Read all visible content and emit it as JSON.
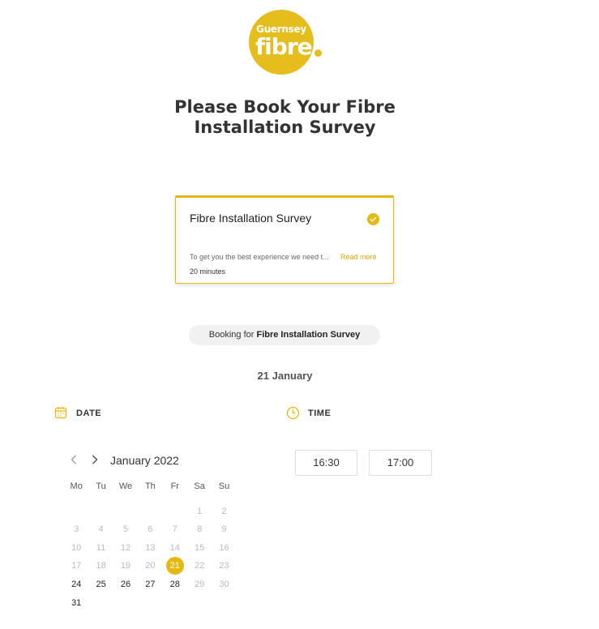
{
  "logo": {
    "line1": "Guernsey",
    "line2": "fibre"
  },
  "page_title_line1": "Please Book Your Fibre",
  "page_title_line2": "Installation Survey",
  "service": {
    "name": "Fibre Installation Survey",
    "description": "To get you the best experience we need t...",
    "read_more": "Read more",
    "duration": "20 minutes"
  },
  "booking": {
    "prefix": "Booking for ",
    "service": "Fibre Installation Survey"
  },
  "selected_date": "21 January",
  "date_label": "DATE",
  "time_label": "TIME",
  "calendar": {
    "month": "January 2022",
    "weekdays": [
      "Mo",
      "Tu",
      "We",
      "Th",
      "Fr",
      "Sa",
      "Su"
    ],
    "weeks": [
      [
        "",
        "",
        "",
        "",
        "",
        "1",
        "2"
      ],
      [
        "3",
        "4",
        "5",
        "6",
        "7",
        "8",
        "9"
      ],
      [
        "10",
        "11",
        "12",
        "13",
        "14",
        "15",
        "16"
      ],
      [
        "17",
        "18",
        "19",
        "20",
        "21",
        "22",
        "23"
      ],
      [
        "24",
        "25",
        "26",
        "27",
        "28",
        "29",
        "30"
      ],
      [
        "31",
        "",
        "",
        "",
        "",
        "",
        ""
      ]
    ],
    "available": [
      "21",
      "24",
      "25",
      "26",
      "27",
      "28",
      "31"
    ],
    "selected": "21"
  },
  "time_slots": [
    "16:30",
    "17:00"
  ],
  "colors": {
    "accent": "#e8b812",
    "logo": "#e5bd1d"
  }
}
